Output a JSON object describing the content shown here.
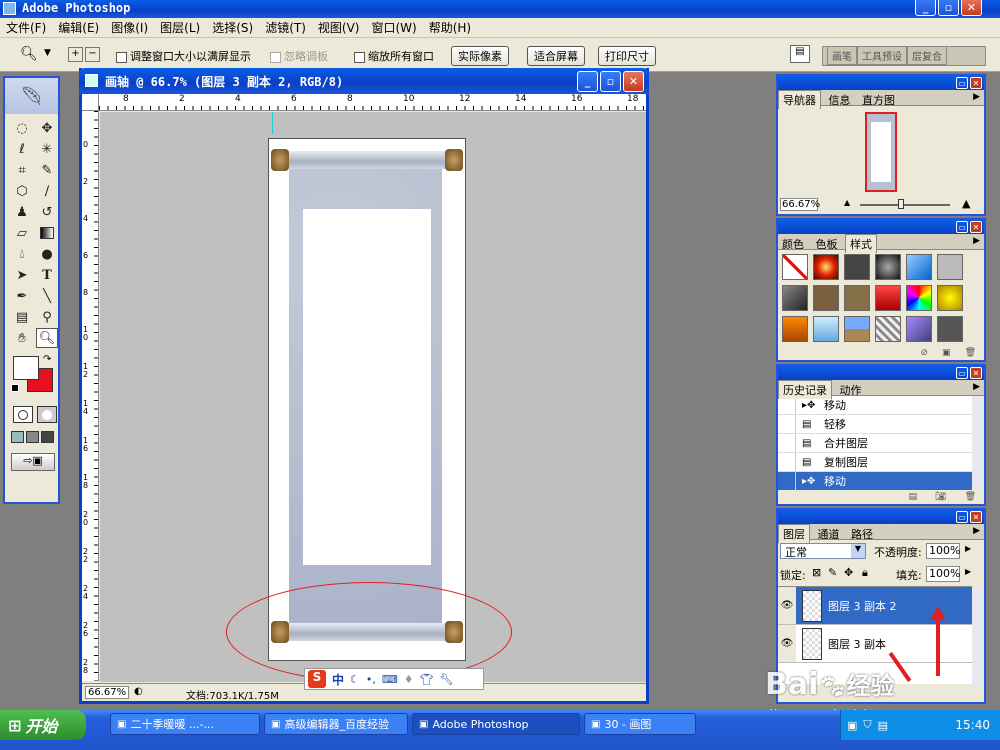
{
  "app": {
    "title": "Adobe Photoshop"
  },
  "menu": [
    "文件(F)",
    "编辑(E)",
    "图像(I)",
    "图层(L)",
    "选择(S)",
    "滤镜(T)",
    "视图(V)",
    "窗口(W)",
    "帮助(H)"
  ],
  "options": {
    "resize_window": "调整窗口大小以满屏显示",
    "ignore_palettes": "忽略调板",
    "zoom_all": "缩放所有窗口",
    "actual_pixels": "实际像素",
    "fit_screen": "适合屏幕",
    "print_size": "打印尺寸",
    "well_tabs": [
      "画笔",
      "工具预设",
      "层复合"
    ]
  },
  "document": {
    "title": "画轴 @ 66.7% (图层 3 副本 2, RGB/8)",
    "zoom": "66.67%",
    "doc_size": "文档:703.1K/1.75M",
    "ruler_h": [
      "8",
      "2",
      "4",
      "6",
      "8",
      "10",
      "12",
      "14",
      "16",
      "18"
    ],
    "ruler_v": [
      "0",
      "2",
      "4",
      "6",
      "8",
      "1 0",
      "1 2",
      "1 4",
      "1 6",
      "1 8",
      "2 0",
      "2 2",
      "2 4",
      "2 6",
      "2 8"
    ]
  },
  "navigator": {
    "tabs": [
      "导航器",
      "信息",
      "直方图"
    ],
    "zoom": "66.67%"
  },
  "swatches": {
    "tabs": [
      "颜色",
      "色板",
      "样式"
    ]
  },
  "history": {
    "tabs": [
      "历史记录",
      "动作"
    ],
    "items": [
      {
        "label": "移动",
        "icon": "move-tool-icon"
      },
      {
        "label": "轻移",
        "icon": "document-icon"
      },
      {
        "label": "合并图层",
        "icon": "document-icon"
      },
      {
        "label": "复制图层",
        "icon": "document-icon"
      },
      {
        "label": "移动",
        "icon": "move-tool-icon",
        "selected": true
      }
    ]
  },
  "layers": {
    "tabs": [
      "图层",
      "通道",
      "路径"
    ],
    "blend_mode": "正常",
    "opacity_label": "不透明度:",
    "opacity": "100%",
    "lock_label": "锁定:",
    "fill_label": "填充:",
    "fill": "100%",
    "items": [
      {
        "name": "图层 3 副本 2",
        "selected": true
      },
      {
        "name": "图层 3 副本",
        "selected": false
      }
    ]
  },
  "ime": {
    "label": "中"
  },
  "taskbar": {
    "start": "开始",
    "buttons": [
      "二十季暖暖 ...-...",
      "高级编辑器_百度经验",
      "Adobe Photoshop",
      "30 - 画图"
    ],
    "clock": "15:40"
  },
  "watermark": {
    "text1": "Bai",
    "text2": "经验",
    "url": "jingyan.baidu.com"
  },
  "colors": {
    "xp_blue": "#0a3fc6",
    "foreground": "#ffffff",
    "background": "#e8101c",
    "annotation": "#e02020"
  }
}
